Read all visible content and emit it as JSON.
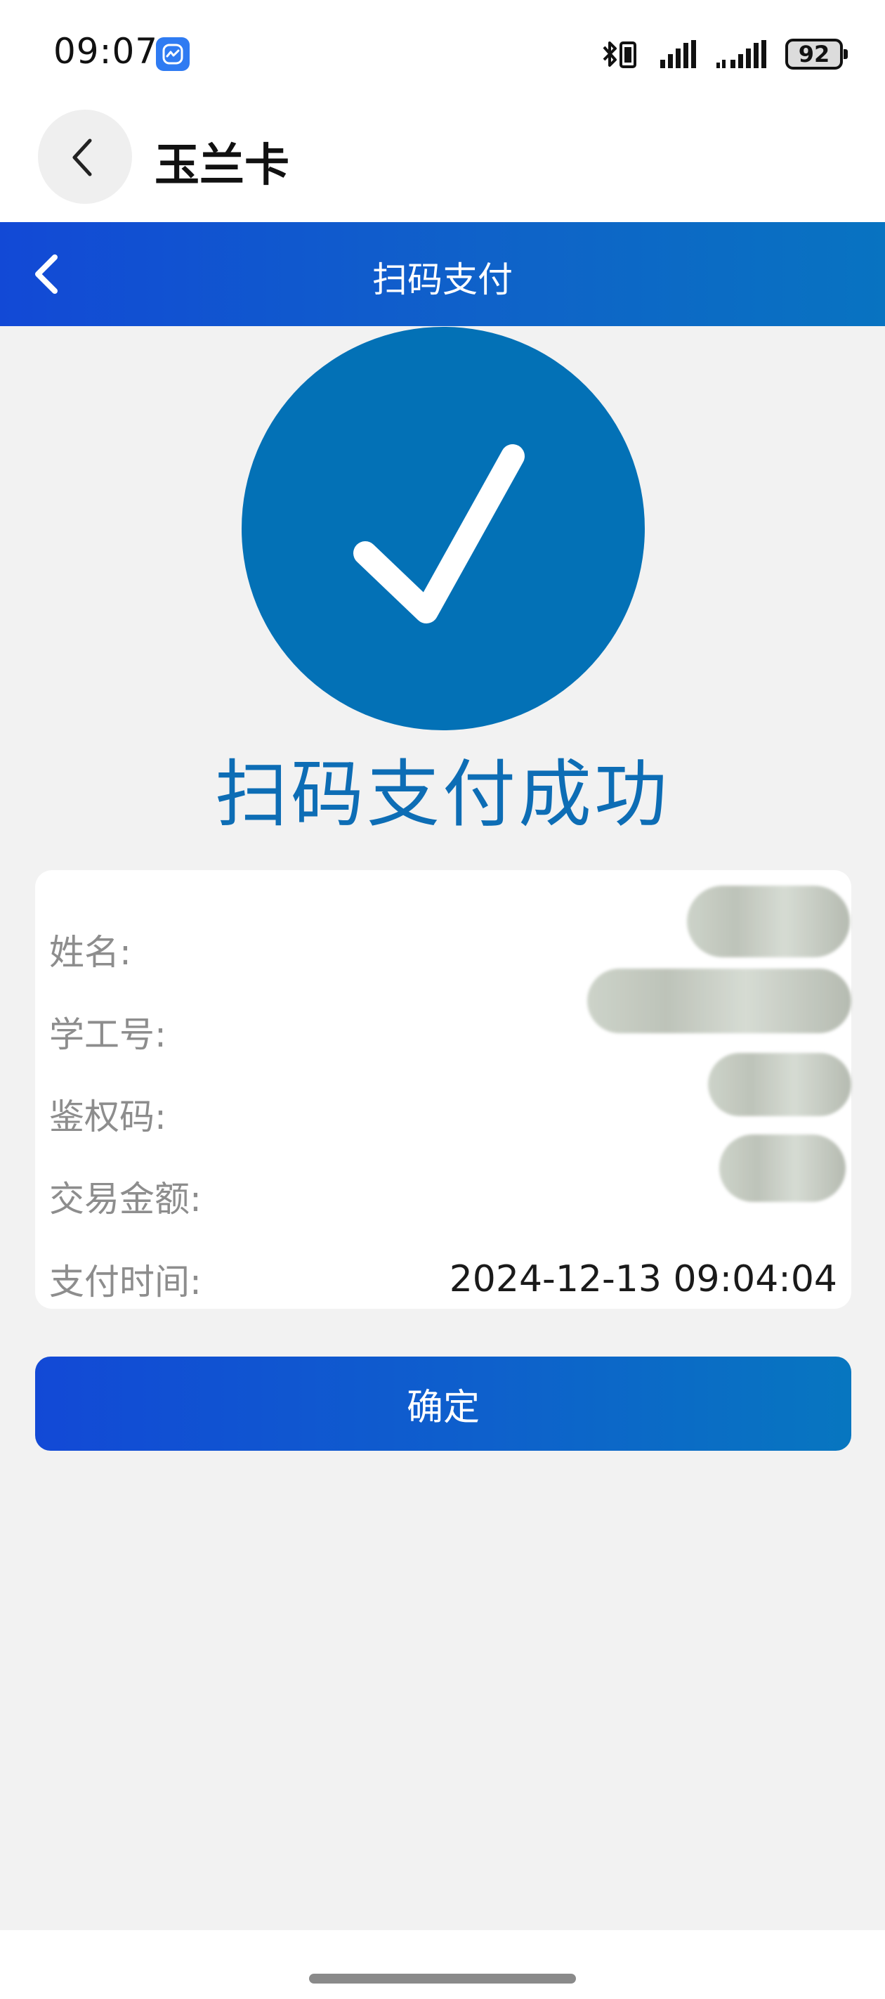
{
  "status_bar": {
    "time": "09:07",
    "battery_level": "92",
    "icons": [
      "app-badge-icon",
      "bluetooth-icon",
      "vibrate-icon",
      "signal-icon",
      "signal-icon",
      "battery-icon"
    ]
  },
  "app_header": {
    "title": "玉兰卡",
    "back_icon": "chevron-left-icon"
  },
  "nav": {
    "title": "扫码支付",
    "back_icon": "chevron-left-icon"
  },
  "result": {
    "icon": "checkmark-icon",
    "title": "扫码支付成功"
  },
  "info": {
    "rows": [
      {
        "label": "姓名:",
        "value": ""
      },
      {
        "label": "学工号:",
        "value": ""
      },
      {
        "label": "鉴权码:",
        "value": ""
      },
      {
        "label": "交易金额:",
        "value": ""
      },
      {
        "label": "支付时间:",
        "value": "2024-12-13 09:04:04"
      }
    ]
  },
  "confirm_label": "确定",
  "colors": {
    "primary_blue": "#0371b6",
    "nav_gradient_start": "#1249d6",
    "nav_gradient_end": "#0873c1",
    "background": "#f2f2f2"
  }
}
